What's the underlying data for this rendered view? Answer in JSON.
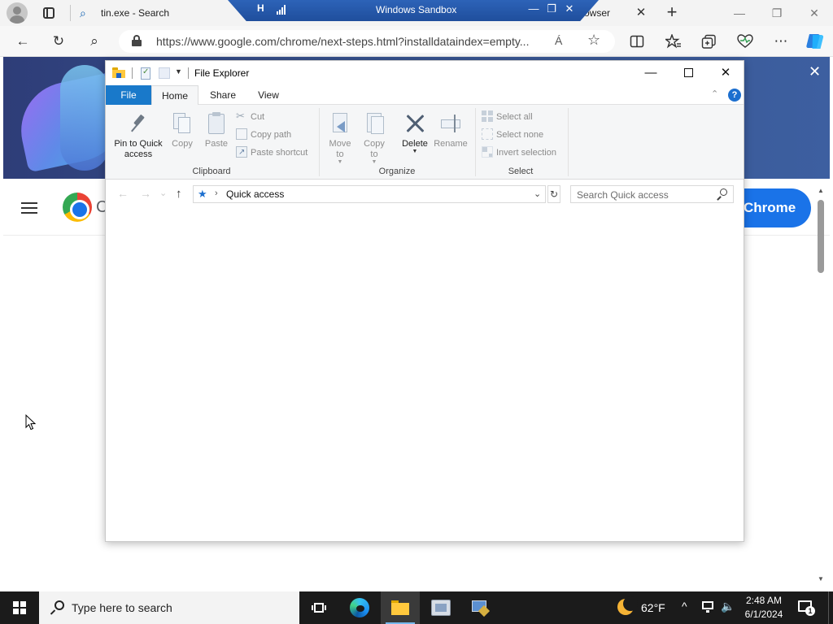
{
  "browser": {
    "tab_title": "tin.exe - Search",
    "tab_right_text": "rowser",
    "url": "https://www.google.com/chrome/next-steps.html?installdataindex=empty...",
    "close_tab_glyph": "✕",
    "new_tab_glyph": "+",
    "window_controls": {
      "minimize": "—",
      "restore": "❐",
      "close": "✕"
    },
    "toolbar": {
      "back": "←",
      "refresh": "↻",
      "search": "⌕",
      "read_aloud": "Á",
      "favorite": "☆"
    }
  },
  "sandbox_bar": {
    "title": "Windows Sandbox",
    "pin_glyph": "H",
    "minimize": "—",
    "restore": "❐",
    "close": "✕"
  },
  "google_page": {
    "logo_text": "C",
    "cta_label": "Chrome",
    "banner_close": "✕"
  },
  "file_explorer": {
    "title": "File Explorer",
    "window_controls": {
      "minimize": "—",
      "close": "✕"
    },
    "tabs": {
      "file": "File",
      "home": "Home",
      "share": "Share",
      "view": "View"
    },
    "help": "?",
    "ribbon": {
      "clipboard": {
        "group_label": "Clipboard",
        "pin_line1": "Pin to Quick",
        "pin_line2": "access",
        "copy": "Copy",
        "paste": "Paste",
        "cut": "Cut",
        "copy_path": "Copy path",
        "paste_shortcut": "Paste shortcut"
      },
      "organize": {
        "group_label": "Organize",
        "move_line1": "Move",
        "move_line2": "to",
        "copy_line1": "Copy",
        "copy_line2": "to",
        "delete": "Delete",
        "rename": "Rename"
      },
      "select": {
        "group_label": "Select",
        "select_all": "Select all",
        "select_none": "Select none",
        "invert_selection": "Invert selection"
      }
    },
    "address": {
      "location": "Quick access",
      "search_placeholder": "Search Quick access",
      "back": "←",
      "forward": "→",
      "recent": "⌄",
      "up": "↑",
      "refresh": "↻",
      "dropdown": "⌄"
    }
  },
  "taskbar": {
    "search_placeholder": "Type here to search",
    "weather_temp": "62°F",
    "time": "2:48 AM",
    "date": "6/1/2024",
    "notification_count": "1",
    "tray_chevron": "^",
    "volume": "🔈"
  }
}
